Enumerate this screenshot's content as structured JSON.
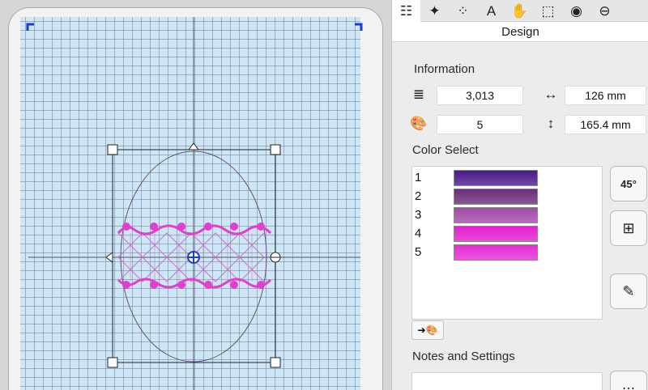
{
  "toolbar": {
    "tabs": [
      {
        "icon": "design-list-icon",
        "glyph": "☷",
        "active": true
      },
      {
        "icon": "sparkle-icon",
        "glyph": "✦",
        "active": false
      },
      {
        "icon": "dot-circle-icon",
        "glyph": "⁘",
        "active": false
      },
      {
        "icon": "text-icon",
        "glyph": "A",
        "active": false
      },
      {
        "icon": "hand-stitch-icon",
        "glyph": "✋",
        "active": false
      },
      {
        "icon": "frame-select-icon",
        "glyph": "⬚",
        "active": false
      },
      {
        "icon": "hoop-icon",
        "glyph": "◉",
        "active": false
      },
      {
        "icon": "zoom-icon",
        "glyph": "⊖",
        "active": false
      }
    ]
  },
  "panel": {
    "title": "Design",
    "information_label": "Information",
    "stitch_count": "3,013",
    "width": "126 mm",
    "color_count": "5",
    "height": "165.4 mm",
    "color_select_label": "Color Select",
    "notes_label": "Notes and Settings",
    "rotate_label": "45°"
  },
  "colors": [
    {
      "num": "1",
      "hex": "#4b1a8c"
    },
    {
      "num": "2",
      "hex": "#6a2e7a"
    },
    {
      "num": "3",
      "hex": "#a24aa8"
    },
    {
      "num": "4",
      "hex": "#e21fcf"
    },
    {
      "num": "5",
      "hex": "#e62bd6"
    }
  ]
}
